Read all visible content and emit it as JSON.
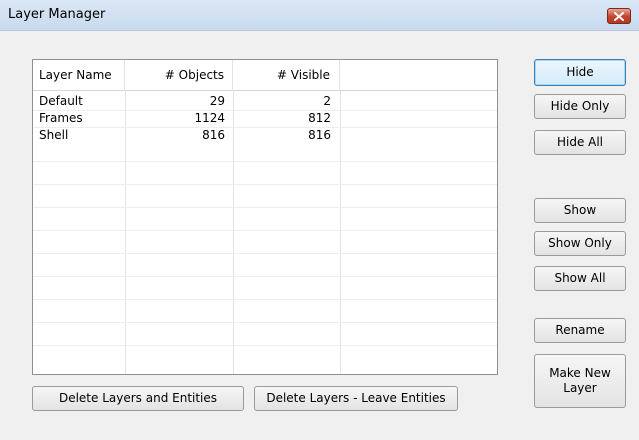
{
  "window": {
    "title": "Layer Manager"
  },
  "table": {
    "columns": [
      "Layer Name",
      "# Objects",
      "# Visible"
    ],
    "rows": [
      {
        "name": "Default",
        "objects": "29",
        "visible": "2"
      },
      {
        "name": "Frames",
        "objects": "1124",
        "visible": "812"
      },
      {
        "name": "Shell",
        "objects": "816",
        "visible": "816"
      }
    ]
  },
  "buttons": {
    "hide": "Hide",
    "hide_only": "Hide Only",
    "hide_all": "Hide All",
    "show": "Show",
    "show_only": "Show Only",
    "show_all": "Show All",
    "rename": "Rename",
    "make_new_layer_line1": "Make New",
    "make_new_layer_line2": "Layer",
    "delete_layers_and_entities": "Delete Layers and Entities",
    "delete_layers_leave_entities": "Delete Layers - Leave Entities"
  }
}
